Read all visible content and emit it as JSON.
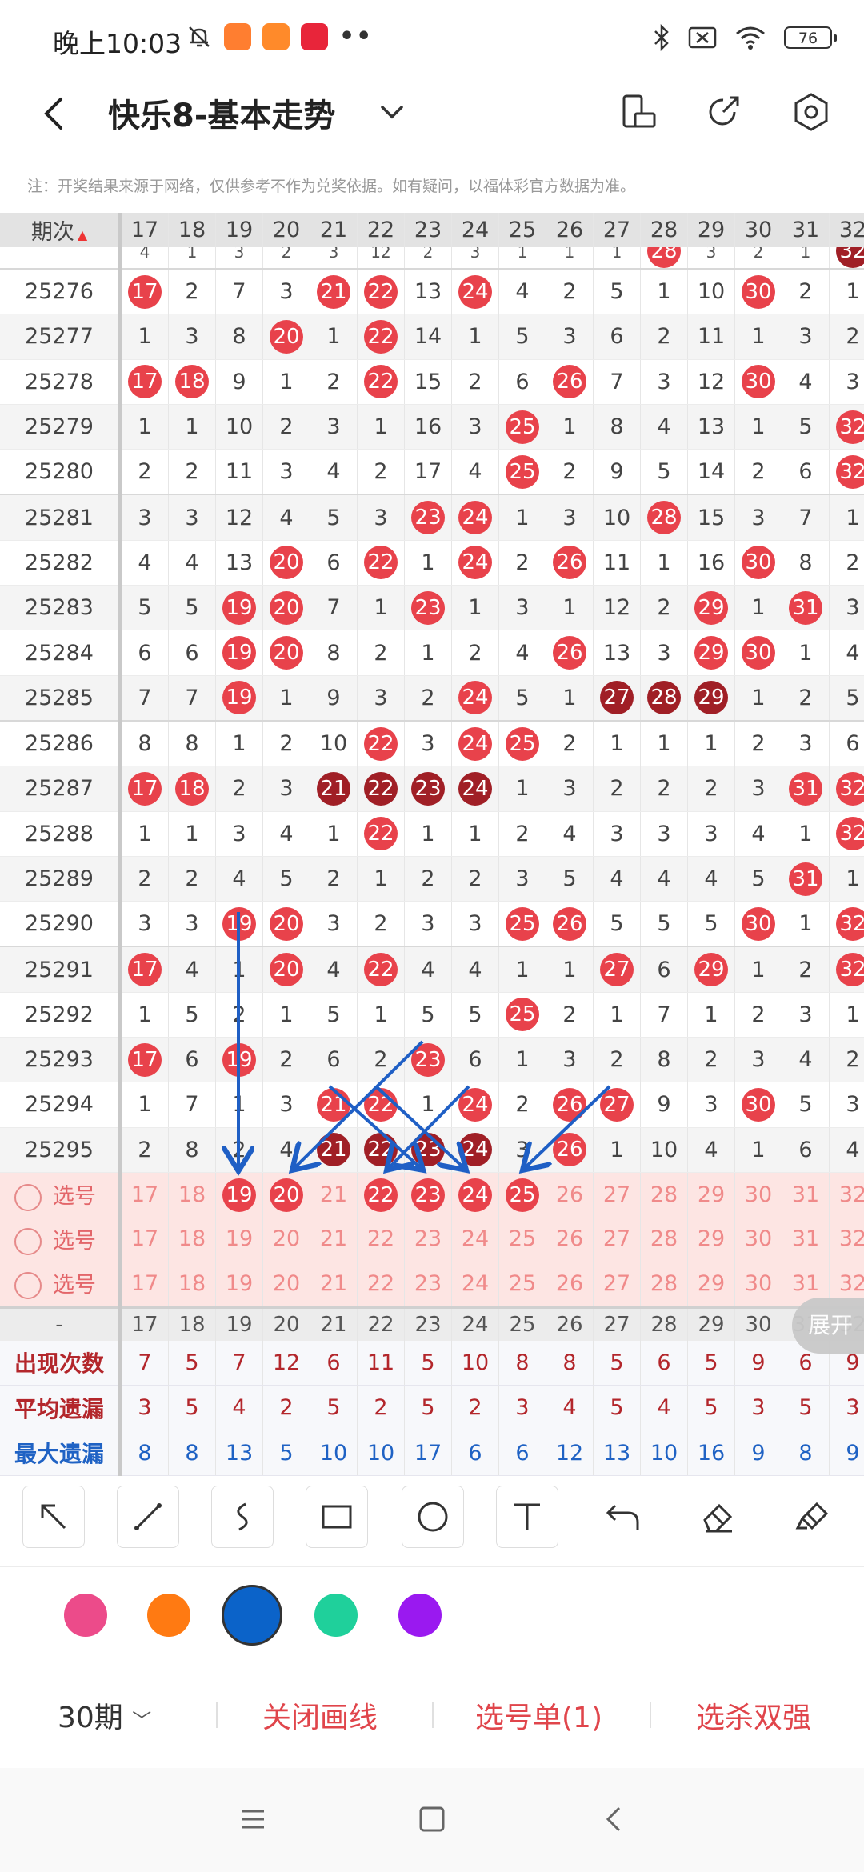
{
  "status": {
    "time": "晚上10:03",
    "battery": "76"
  },
  "header": {
    "title": "快乐8-基本走势",
    "notice": "注：开奖结果来源于网络，仅供参考不作为兑奖依据。如有疑问，以福体彩官方数据为准。"
  },
  "table": {
    "period_header": "期次",
    "columns": [
      "17",
      "18",
      "19",
      "20",
      "21",
      "22",
      "23",
      "24",
      "25",
      "26",
      "27",
      "28",
      "29",
      "30",
      "31",
      "32"
    ],
    "partial_row": [
      "4",
      "1",
      "3",
      "2",
      "3",
      "12",
      "2",
      "3",
      "1",
      "1",
      "1",
      "28",
      "3",
      "2",
      "1",
      "32"
    ],
    "rows": [
      {
        "period": "25276",
        "cells": [
          "17",
          "2",
          "7",
          "3",
          "21",
          "22",
          "13",
          "24",
          "4",
          "2",
          "5",
          "1",
          "10",
          "30",
          "2",
          "1"
        ],
        "hits": [
          0,
          4,
          5,
          7,
          13
        ]
      },
      {
        "period": "25277",
        "cells": [
          "1",
          "3",
          "8",
          "20",
          "1",
          "22",
          "14",
          "1",
          "5",
          "3",
          "6",
          "2",
          "11",
          "1",
          "3",
          "2"
        ],
        "hits": [
          3,
          5
        ]
      },
      {
        "period": "25278",
        "cells": [
          "17",
          "18",
          "9",
          "1",
          "2",
          "22",
          "15",
          "2",
          "6",
          "26",
          "7",
          "3",
          "12",
          "30",
          "4",
          "3"
        ],
        "hits": [
          0,
          1,
          5,
          9,
          13
        ]
      },
      {
        "period": "25279",
        "cells": [
          "1",
          "1",
          "10",
          "2",
          "3",
          "1",
          "16",
          "3",
          "25",
          "1",
          "8",
          "4",
          "13",
          "1",
          "5",
          "32"
        ],
        "hits": [
          8,
          15
        ]
      },
      {
        "period": "25280",
        "cells": [
          "2",
          "2",
          "11",
          "3",
          "4",
          "2",
          "17",
          "4",
          "25",
          "2",
          "9",
          "5",
          "14",
          "2",
          "6",
          "32"
        ],
        "hits": [
          8,
          15
        ]
      },
      {
        "period": "25281",
        "cells": [
          "3",
          "3",
          "12",
          "4",
          "5",
          "3",
          "23",
          "24",
          "1",
          "3",
          "10",
          "28",
          "15",
          "3",
          "7",
          "1"
        ],
        "hits": [
          6,
          7,
          11
        ]
      },
      {
        "period": "25282",
        "cells": [
          "4",
          "4",
          "13",
          "20",
          "6",
          "22",
          "1",
          "24",
          "2",
          "26",
          "11",
          "1",
          "16",
          "30",
          "8",
          "2"
        ],
        "hits": [
          3,
          5,
          7,
          9,
          13
        ]
      },
      {
        "period": "25283",
        "cells": [
          "5",
          "5",
          "19",
          "20",
          "7",
          "1",
          "23",
          "1",
          "3",
          "1",
          "12",
          "2",
          "29",
          "1",
          "31",
          "3"
        ],
        "hits": [
          2,
          3,
          6,
          12,
          14
        ]
      },
      {
        "period": "25284",
        "cells": [
          "6",
          "6",
          "19",
          "20",
          "8",
          "2",
          "1",
          "2",
          "4",
          "26",
          "13",
          "3",
          "29",
          "30",
          "1",
          "4"
        ],
        "hits": [
          2,
          3,
          9,
          12,
          13
        ]
      },
      {
        "period": "25285",
        "cells": [
          "7",
          "7",
          "19",
          "1",
          "9",
          "3",
          "2",
          "24",
          "5",
          "1",
          "27",
          "28",
          "29",
          "1",
          "2",
          "5"
        ],
        "hits": [
          2,
          7,
          10,
          11,
          12
        ],
        "dark": [
          10,
          11,
          12
        ]
      },
      {
        "period": "25286",
        "cells": [
          "8",
          "8",
          "1",
          "2",
          "10",
          "22",
          "3",
          "24",
          "25",
          "2",
          "1",
          "1",
          "1",
          "2",
          "3",
          "6"
        ],
        "hits": [
          5,
          7,
          8
        ]
      },
      {
        "period": "25287",
        "cells": [
          "17",
          "18",
          "2",
          "3",
          "21",
          "22",
          "23",
          "24",
          "1",
          "3",
          "2",
          "2",
          "2",
          "3",
          "31",
          "32"
        ],
        "hits": [
          0,
          1,
          4,
          5,
          6,
          7,
          14,
          15
        ],
        "dark": [
          4,
          5,
          6,
          7
        ]
      },
      {
        "period": "25288",
        "cells": [
          "1",
          "1",
          "3",
          "4",
          "1",
          "22",
          "1",
          "1",
          "2",
          "4",
          "3",
          "3",
          "3",
          "4",
          "1",
          "32"
        ],
        "hits": [
          5,
          15
        ]
      },
      {
        "period": "25289",
        "cells": [
          "2",
          "2",
          "4",
          "5",
          "2",
          "1",
          "2",
          "2",
          "3",
          "5",
          "4",
          "4",
          "4",
          "5",
          "31",
          "1"
        ],
        "hits": [
          14
        ]
      },
      {
        "period": "25290",
        "cells": [
          "3",
          "3",
          "19",
          "20",
          "3",
          "2",
          "3",
          "3",
          "25",
          "26",
          "5",
          "5",
          "5",
          "30",
          "1",
          "32"
        ],
        "hits": [
          2,
          3,
          8,
          9,
          13,
          15
        ]
      },
      {
        "period": "25291",
        "cells": [
          "17",
          "4",
          "1",
          "20",
          "4",
          "22",
          "4",
          "4",
          "1",
          "1",
          "27",
          "6",
          "29",
          "1",
          "2",
          "32"
        ],
        "hits": [
          0,
          3,
          5,
          10,
          12,
          15
        ]
      },
      {
        "period": "25292",
        "cells": [
          "1",
          "5",
          "2",
          "1",
          "5",
          "1",
          "5",
          "5",
          "25",
          "2",
          "1",
          "7",
          "1",
          "2",
          "3",
          "1"
        ],
        "hits": [
          8
        ]
      },
      {
        "period": "25293",
        "cells": [
          "17",
          "6",
          "19",
          "2",
          "6",
          "2",
          "23",
          "6",
          "1",
          "3",
          "2",
          "8",
          "2",
          "3",
          "4",
          "2"
        ],
        "hits": [
          0,
          2,
          6
        ]
      },
      {
        "period": "25294",
        "cells": [
          "1",
          "7",
          "1",
          "3",
          "21",
          "22",
          "1",
          "24",
          "2",
          "26",
          "27",
          "9",
          "3",
          "30",
          "5",
          "3"
        ],
        "hits": [
          4,
          5,
          7,
          9,
          10,
          13
        ]
      },
      {
        "period": "25295",
        "cells": [
          "2",
          "8",
          "2",
          "4",
          "21",
          "22",
          "23",
          "24",
          "3",
          "26",
          "1",
          "10",
          "4",
          "1",
          "6",
          "4"
        ],
        "hits": [
          4,
          5,
          6,
          7,
          9
        ],
        "dark": [
          4,
          5,
          6,
          7
        ]
      }
    ],
    "pick_label": "选号",
    "pick_selected": [
      2,
      3,
      5,
      6,
      7,
      8
    ],
    "footer_dash": "-",
    "stats": [
      {
        "label": "出现次数",
        "values": [
          "7",
          "5",
          "7",
          "12",
          "6",
          "11",
          "5",
          "10",
          "8",
          "8",
          "5",
          "6",
          "5",
          "9",
          "6",
          "9"
        ]
      },
      {
        "label": "平均遗漏",
        "values": [
          "3",
          "5",
          "4",
          "2",
          "5",
          "2",
          "5",
          "2",
          "3",
          "4",
          "5",
          "4",
          "5",
          "3",
          "5",
          "3"
        ]
      },
      {
        "label": "最大遗漏",
        "values": [
          "8",
          "8",
          "13",
          "5",
          "10",
          "10",
          "17",
          "6",
          "6",
          "12",
          "13",
          "10",
          "16",
          "9",
          "8",
          "9"
        ]
      }
    ],
    "expand_label": "展开"
  },
  "tools": [
    "arrow-tool",
    "line-tool",
    "curve-tool",
    "rect-tool",
    "circle-tool",
    "text-tool",
    "undo-tool",
    "eraser-tool",
    "clear-tool"
  ],
  "colors": [
    "#ec4b8a",
    "#ff7a12",
    "#0b63c9",
    "#1fd09b",
    "#9a19f0"
  ],
  "selected_color": 2,
  "bottom": {
    "period": "30期",
    "close_line": "关闭画线",
    "pick_list": "选号单(1)",
    "kill": "选杀双强"
  }
}
